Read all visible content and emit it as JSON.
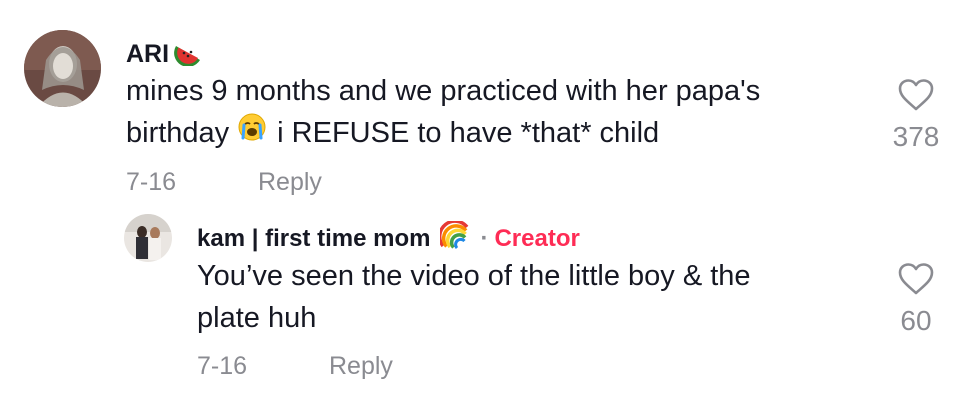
{
  "comments": [
    {
      "username": "ARI",
      "username_emoji": "watermelon-icon",
      "text_line1": "mines 9 months and we practiced with her papa's",
      "text_line2_pre": "birthday",
      "text_emoji": "crying-face-icon",
      "text_line2_post": "i REFUSE to have *that* child",
      "date": "7-16",
      "reply_label": "Reply",
      "likes": "378"
    }
  ],
  "replies": [
    {
      "username": "kam | first time mom",
      "username_emoji": "rainbow-icon",
      "separator": "·",
      "badge": "Creator",
      "text_line1": "You’ve seen the video of the little boy & the",
      "text_line2": "plate huh",
      "date": "7-16",
      "reply_label": "Reply",
      "likes": "60"
    }
  ],
  "colors": {
    "text": "#161823",
    "muted": "#8a8b91",
    "creator": "#fe2c55"
  }
}
